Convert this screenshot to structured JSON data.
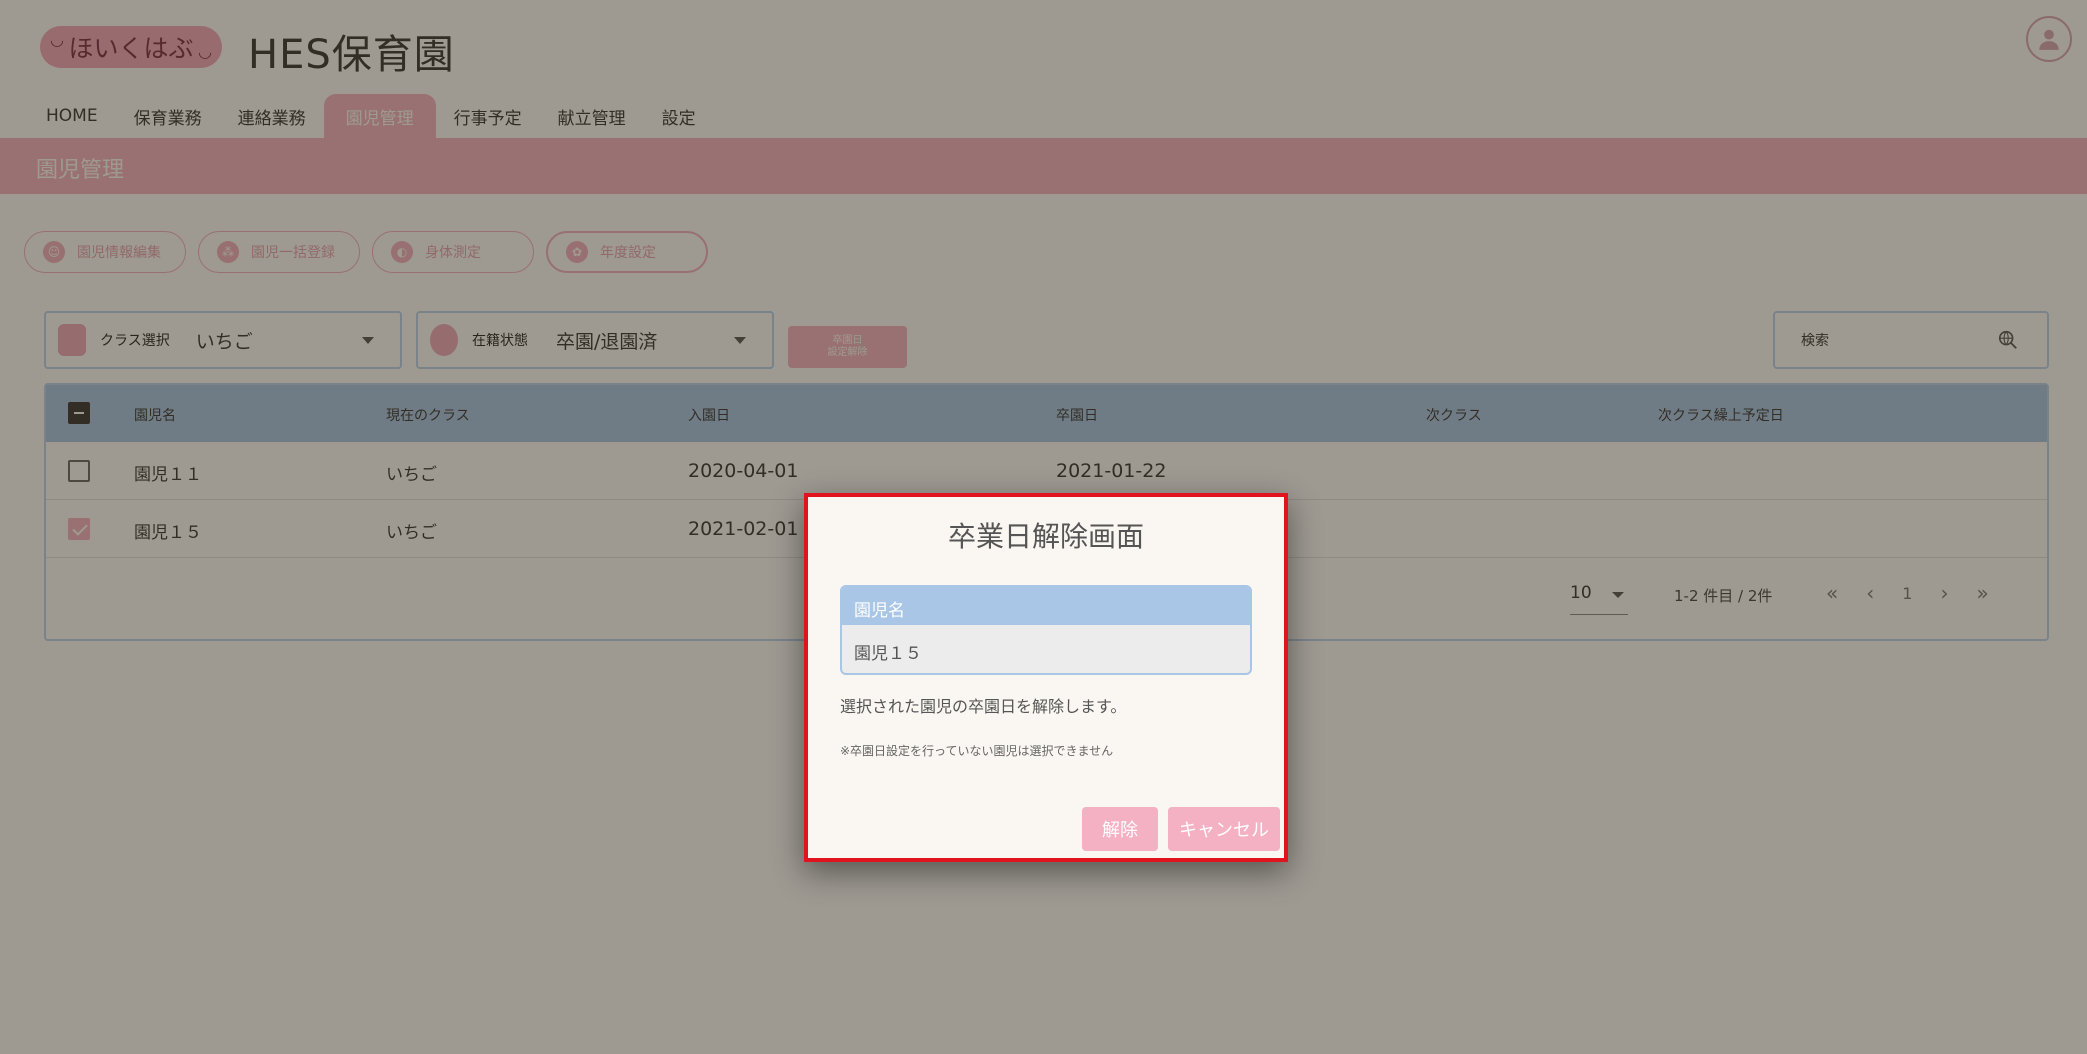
{
  "app": {
    "logo_text": "ほいくはぶ",
    "logo_face": "◡",
    "org_name": "HES保育園"
  },
  "nav": {
    "tabs": [
      "HOME",
      "保育業務",
      "連絡業務",
      "園児管理",
      "行事予定",
      "献立管理",
      "設定"
    ],
    "active": "園児管理"
  },
  "page": {
    "title": "園児管理"
  },
  "actions": [
    "園児情報編集",
    "園児一括登録",
    "身体測定",
    "年度設定"
  ],
  "filters": {
    "class_label": "クラス選択",
    "class_value": "いちご",
    "status_label": "在籍状態",
    "status_value": "卒園/退園済",
    "grad_button_line1": "卒園日",
    "grad_button_line2": "設定解除"
  },
  "search": {
    "placeholder": "検索"
  },
  "table": {
    "headers": [
      "園児名",
      "現在のクラス",
      "入園日",
      "卒園日",
      "次クラス",
      "次クラス繰上予定日"
    ],
    "rows": [
      {
        "name": "園児１１",
        "class": "いちご",
        "enroll": "2020-04-01",
        "graduate": "2021-01-22",
        "checked": false
      },
      {
        "name": "園児１５",
        "class": "いちご",
        "enroll": "2021-02-01",
        "graduate": "",
        "checked": true
      }
    ]
  },
  "pager": {
    "size": "10",
    "info": "1-2 件目 / 2件",
    "first": "«",
    "prev": "‹",
    "page": "1",
    "next": "›",
    "last": "»"
  },
  "dialog": {
    "title": "卒業日解除画面",
    "table_header": "園児名",
    "table_value": "園児１５",
    "message": "選択された園児の卒園日を解除します。",
    "note": "※卒園日設定を行っていない園児は選択できません",
    "confirm_label": "解除",
    "cancel_label": "キャンセル"
  },
  "colors": {
    "accent_pink": "#f5b1c4",
    "header_blue": "#a9c6e6",
    "highlight_red": "#e0131e"
  }
}
